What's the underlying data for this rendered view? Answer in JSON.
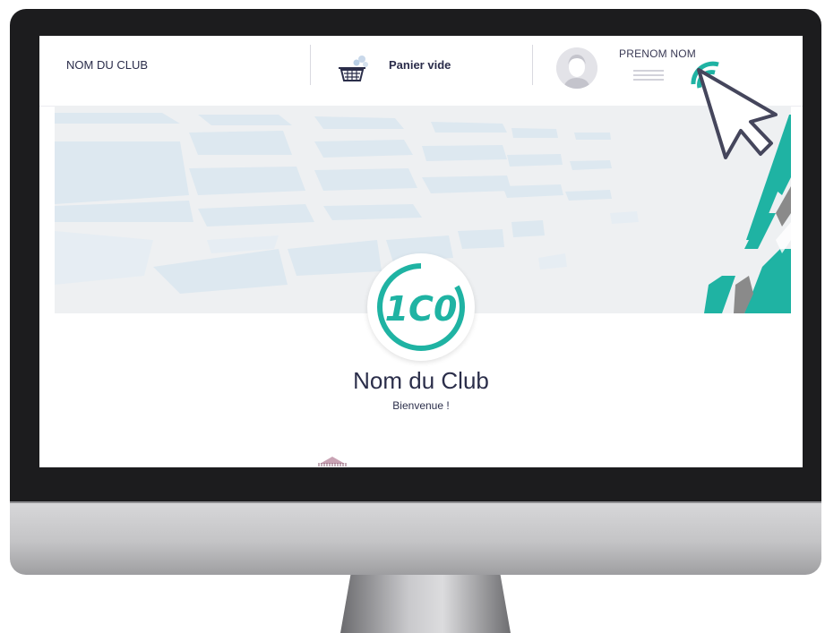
{
  "header": {
    "club_name": "NOM DU CLUB",
    "cart_label": "Panier vide",
    "user_name": "PRENOM NOM"
  },
  "main": {
    "title": "Nom du Club",
    "subtitle": "Bienvenue !",
    "logo_text": "1C0"
  },
  "colors": {
    "accent": "#1fb3a3",
    "text": "#2b2e4a",
    "bezel": "#1c1c1e"
  },
  "icons": [
    "basket-icon",
    "avatar-icon",
    "menu-icon",
    "cursor-icon",
    "click-ripple-icon"
  ]
}
